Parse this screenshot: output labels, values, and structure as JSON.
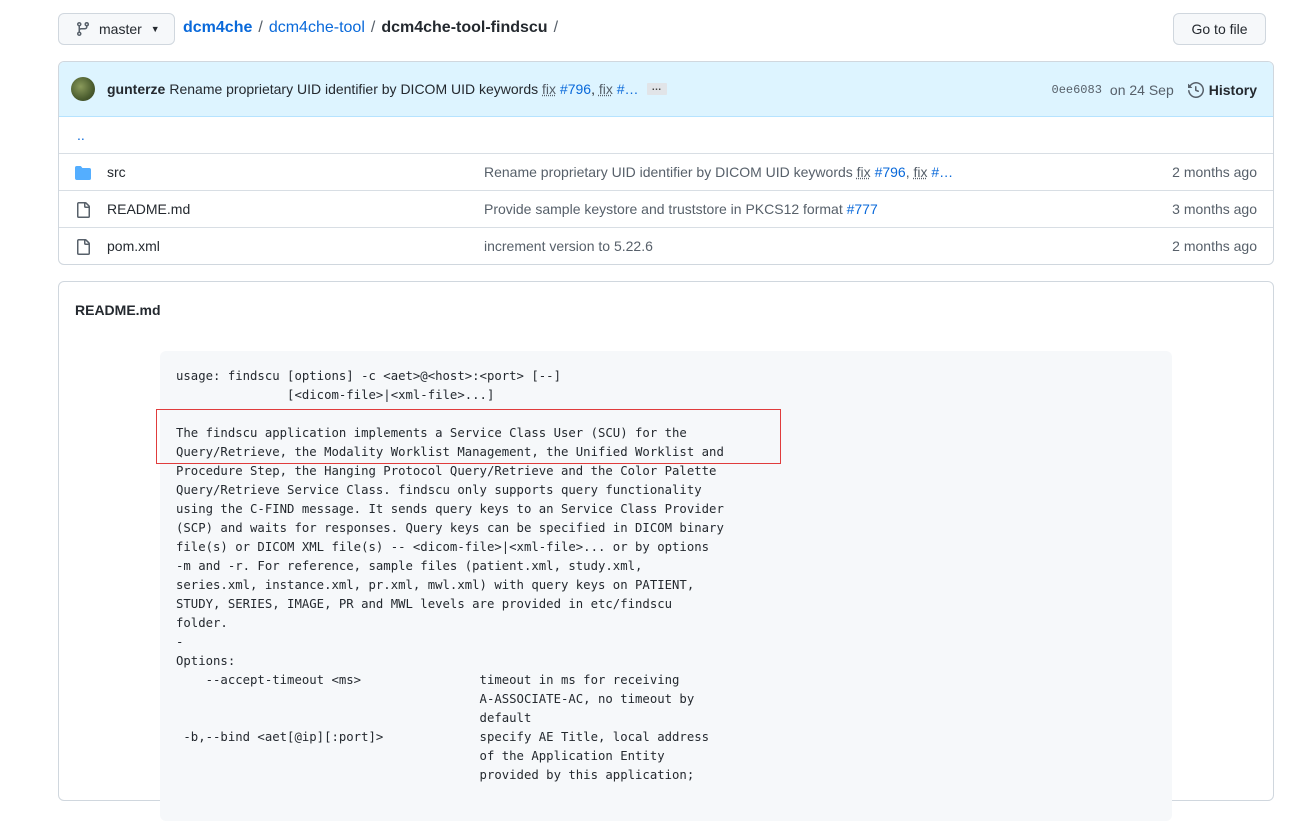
{
  "header": {
    "branch": "master",
    "breadcrumb": [
      {
        "label": "dcm4che",
        "link": true
      },
      {
        "label": "dcm4che-tool",
        "link": true
      },
      {
        "label": "dcm4che-tool-findscu",
        "link": false
      }
    ],
    "separator": "/",
    "go_to_file": "Go to file"
  },
  "commit": {
    "author": "gunterze",
    "message_prefix": "Rename proprietary UID identifier by DICOM UID keywords",
    "fix1": "fix",
    "issue1": "#796",
    "comma": ",",
    "fix2": "fix",
    "issue2": "#…",
    "more": "…",
    "sha": "0ee6083",
    "date": "on 24 Sep",
    "history": "History"
  },
  "files": {
    "parent": "..",
    "rows": [
      {
        "type": "dir",
        "name": "src",
        "msg": "Rename proprietary UID identifier by DICOM UID keywords",
        "fix1": "fix",
        "issue1": "#796",
        "fix2": "fix",
        "issue2": "#…",
        "age": "2 months ago"
      },
      {
        "type": "file",
        "name": "README.md",
        "msg": "Provide sample keystore and truststore in PKCS12 format",
        "issue1": "#777",
        "age": "3 months ago"
      },
      {
        "type": "file",
        "name": "pom.xml",
        "msg": "increment version to 5.22.6",
        "age": "2 months ago"
      }
    ]
  },
  "readme": {
    "title": "README.md",
    "code": "usage: findscu [options] -c <aet>@<host>:<port> [--]\n               [<dicom-file>|<xml-file>...]\n\nThe findscu application implements a Service Class User (SCU) for the\nQuery/Retrieve, the Modality Worklist Management, the Unified Worklist and\nProcedure Step, the Hanging Protocol Query/Retrieve and the Color Palette\nQuery/Retrieve Service Class. findscu only supports query functionality\nusing the C-FIND message. It sends query keys to an Service Class Provider\n(SCP) and waits for responses. Query keys can be specified in DICOM binary\nfile(s) or DICOM XML file(s) -- <dicom-file>|<xml-file>... or by options\n-m and -r. For reference, sample files (patient.xml, study.xml,\nseries.xml, instance.xml, pr.xml, mwl.xml) with query keys on PATIENT,\nSTUDY, SERIES, IMAGE, PR and MWL levels are provided in etc/findscu\nfolder.\n-\nOptions:\n    --accept-timeout <ms>                timeout in ms for receiving\n                                         A-ASSOCIATE-AC, no timeout by\n                                         default\n -b,--bind <aet[@ip][:port]>             specify AE Title, local address\n                                         of the Application Entity\n                                         provided by this application;"
  },
  "colors": {
    "link": "#0969da",
    "commit_bar_bg": "#ddf4ff",
    "folder_icon": "#54aeff",
    "highlight": "#e03c3c"
  },
  "icons": {
    "branch": "git-branch-icon",
    "folder": "folder-icon",
    "file": "file-icon",
    "history": "history-clock-icon"
  }
}
